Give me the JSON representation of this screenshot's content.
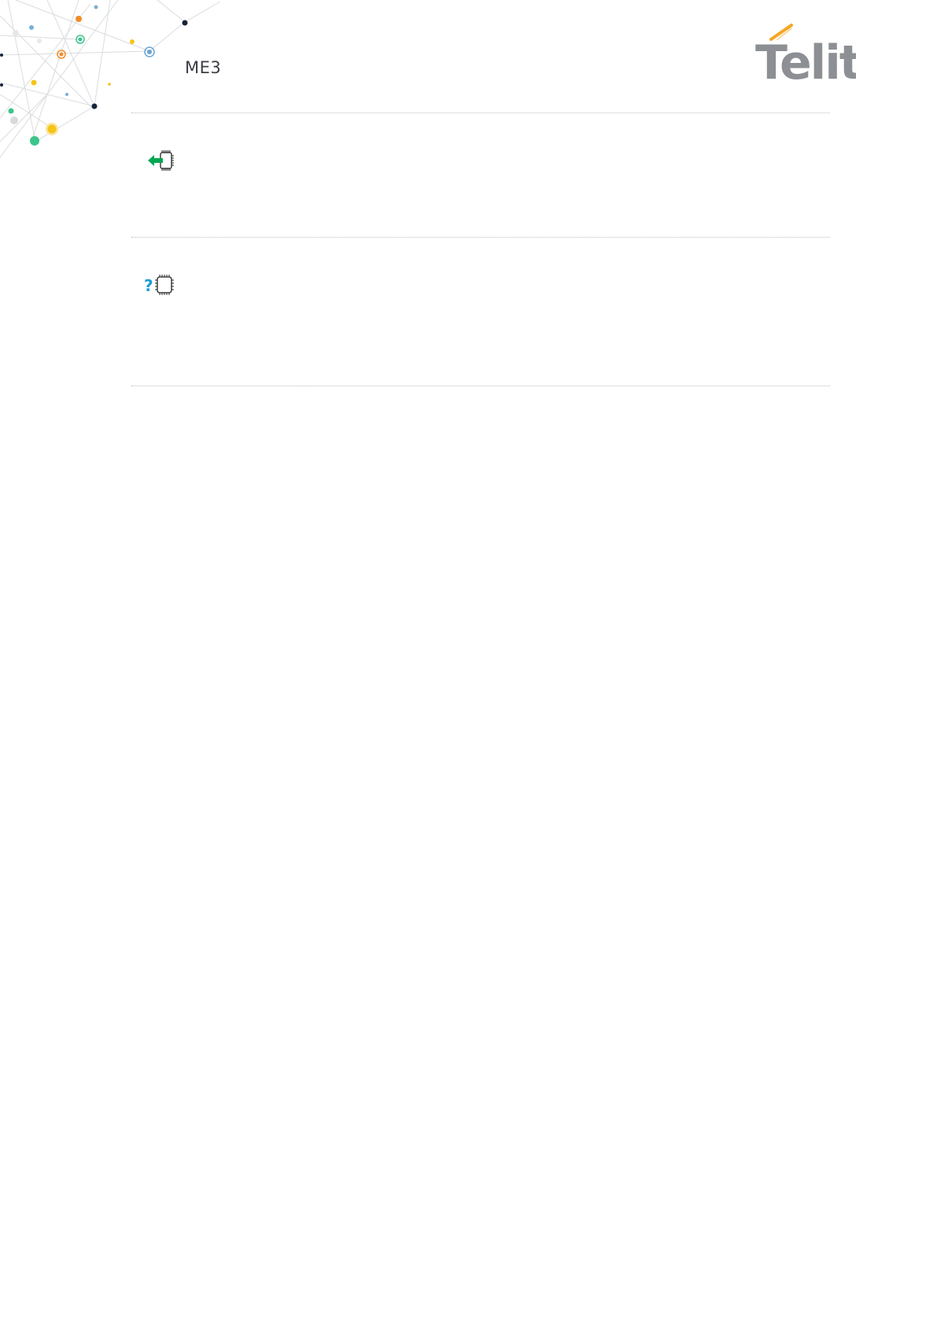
{
  "header": {
    "code": "ME3",
    "logo_text": "Telit"
  },
  "colors": {
    "logo_gray": "#8c8f93",
    "logo_accent": "#f5a623",
    "arrow_green": "#00a651",
    "question_blue": "#1a9bd7"
  },
  "icons": {
    "set_command": "arrow-into-chip-icon",
    "read_command": "question-chip-icon"
  }
}
